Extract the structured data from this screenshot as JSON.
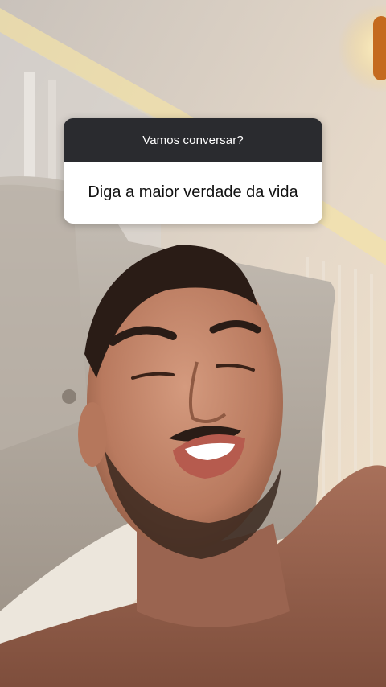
{
  "question_sticker": {
    "prompt": "Vamos conversar?",
    "answer": "Diga a maior verdade da vida"
  },
  "colors": {
    "sticker_header": "#2a2b2f",
    "sticker_body": "#ffffff",
    "sticker_header_text": "#ffffff",
    "sticker_body_text": "#111111"
  }
}
